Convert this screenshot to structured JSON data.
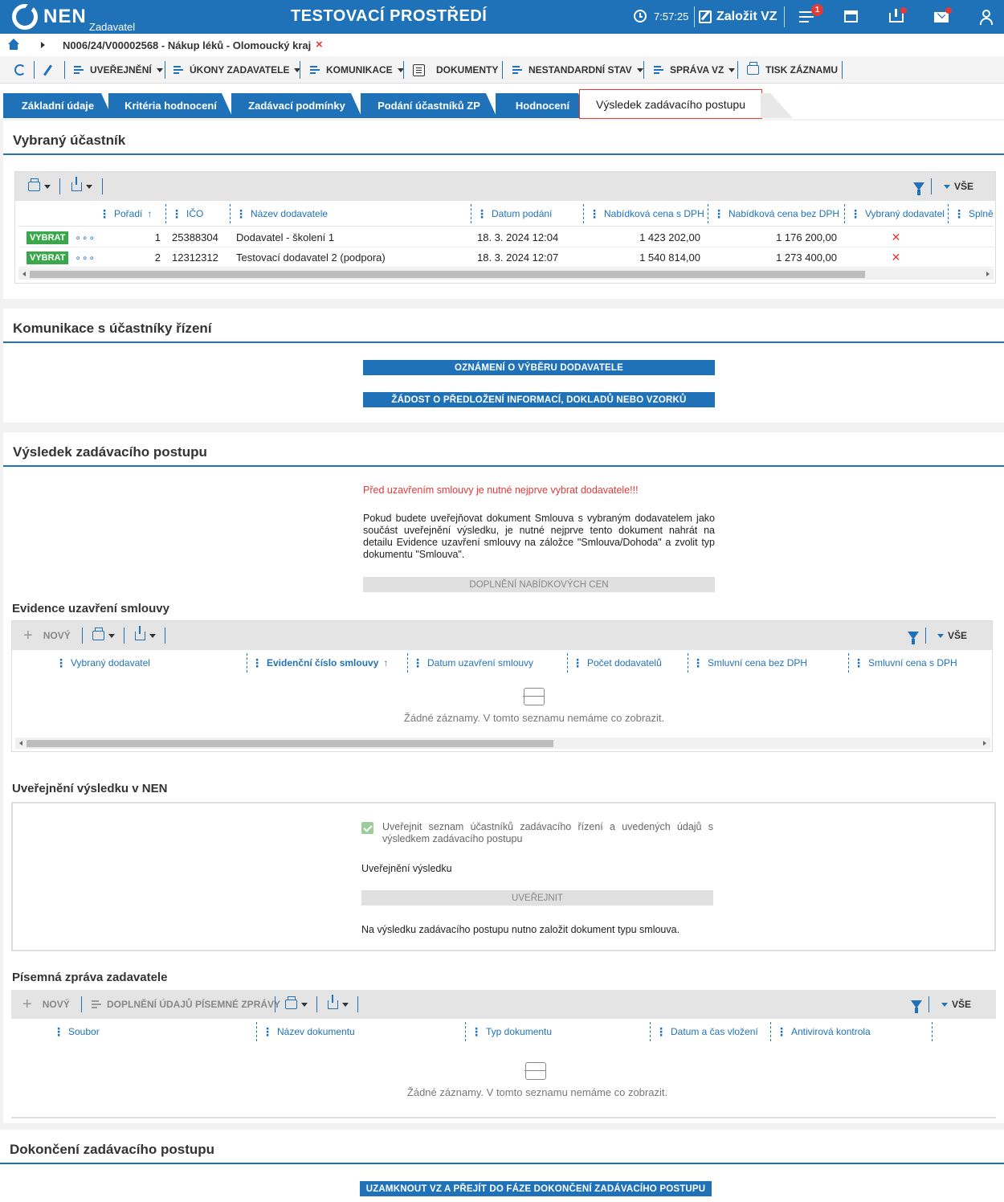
{
  "header": {
    "logo_text": "NEN",
    "logo_sub": "Zadavatel",
    "env_title": "TESTOVACÍ PROSTŘEDÍ",
    "clock": "7:57:25",
    "new_vz_label": "Založit VZ",
    "menu_badge": "1",
    "accent_color": "#1f72b8"
  },
  "breadcrumb": {
    "text": "N006/24/V00002568 - Nákup léků - Olomoucký kraj",
    "close": "×"
  },
  "toolbar": {
    "uverejneni": "UVEŘEJNĚNÍ",
    "ukony": "ÚKONY ZADAVATELE",
    "komunikace": "KOMUNIKACE",
    "dokumenty": "DOKUMENTY",
    "nestandardni": "NESTANDARDNÍ STAV",
    "sprava": "SPRÁVA VZ",
    "tisk": "TISK ZÁZNAMU"
  },
  "tabs": [
    {
      "label": "Základní údaje"
    },
    {
      "label": "Kritéria hodnocení"
    },
    {
      "label": "Zadávací podmínky"
    },
    {
      "label": "Podání účastníků ZP"
    },
    {
      "label": "Hodnocení"
    },
    {
      "label": "Výsledek zadávacího postupu"
    }
  ],
  "selected": {
    "title": "Vybraný účastník",
    "vse": "VŠE",
    "columns": [
      "Pořadí",
      "IČO",
      "Název dodavatele",
      "Datum podání",
      "Nabídková cena s DPH",
      "Nabídková cena bez DPH",
      "Vybraný dodavatel",
      "Splně"
    ],
    "vybrat_label": "VYBRAT",
    "more": "∘∘∘",
    "rows": [
      {
        "poradi": "1",
        "ico": "25388304",
        "nazev": "Dodavatel - školení 1",
        "datum": "18. 3. 2024 12:04",
        "cena_s": "1 423 202,00",
        "cena_bez": "1 176 200,00",
        "vybrany": "✕"
      },
      {
        "poradi": "2",
        "ico": "12312312",
        "nazev": "Testovací dodavatel 2 (podpora)",
        "datum": "18. 3. 2024 12:07",
        "cena_s": "1 540 814,00",
        "cena_bez": "1 273 400,00",
        "vybrany": "✕"
      }
    ]
  },
  "komunikace": {
    "title": "Komunikace s účastníky řízení",
    "btn1": "OZNÁMENÍ O VÝBĚRU DODAVATELE",
    "btn2": "ŽÁDOST O PŘEDLOŽENÍ INFORMACÍ, DOKLADŮ NEBO VZORKŮ"
  },
  "vysledek": {
    "title": "Výsledek zadávacího postupu",
    "warning": "Před uzavřením smlouvy je nutné nejprve vybrat dodavatele!!!",
    "info": "Pokud budete uveřejňovat dokument Smlouva s vybraným dodavatelem jako součást uveřejnění výsledku, je nutné nejprve tento dokument nahrát na detailu Evidence uzavření smlouvy na záložce \"Smlouva/Dohoda\" a zvolit typ dokumentu \"Smlouva\".",
    "doplneni_btn": "DOPLNĚNÍ NABÍDKOVÝCH CEN"
  },
  "evidence": {
    "title": "Evidence uzavření smlouvy",
    "novy": "NOVÝ",
    "vse": "VŠE",
    "columns": [
      "Vybraný dodavatel",
      "Evidenční číslo smlouvy",
      "Datum uzavření smlouvy",
      "Počet dodavatelů",
      "Smluvní cena bez DPH",
      "Smluvní cena s DPH"
    ],
    "empty": "Žádné záznamy. V tomto seznamu nemáme co zobrazit."
  },
  "uverejneni": {
    "title": "Uveřejnění výsledku v NEN",
    "checkbox_label": "Uveřejnit seznam účastníků zadávacího řízení a uvedených údajů s výsledkem zadávacího postupu",
    "label": "Uveřejnění výsledku",
    "btn": "UVEŘEJNIT",
    "note": "Na výsledku zadávacího postupu nutno založit dokument typu smlouva."
  },
  "pisemna": {
    "title": "Písemná zpráva zadavatele",
    "novy": "NOVÝ",
    "doplneni": "DOPLNĚNÍ ÚDAJŮ PÍSEMNÉ ZPRÁVY",
    "vse": "VŠE",
    "columns": [
      "Soubor",
      "Název dokumentu",
      "Typ dokumentu",
      "Datum a čas vložení",
      "Antivirová kontrola"
    ],
    "empty": "Žádné záznamy. V tomto seznamu nemáme co zobrazit."
  },
  "dokonceni": {
    "title": "Dokončení zadávacího postupu",
    "btn": "UZAMKNOUT VZ A PŘEJÍT DO FÁZE DOKONČENÍ ZADÁVACÍHO POSTUPU"
  }
}
